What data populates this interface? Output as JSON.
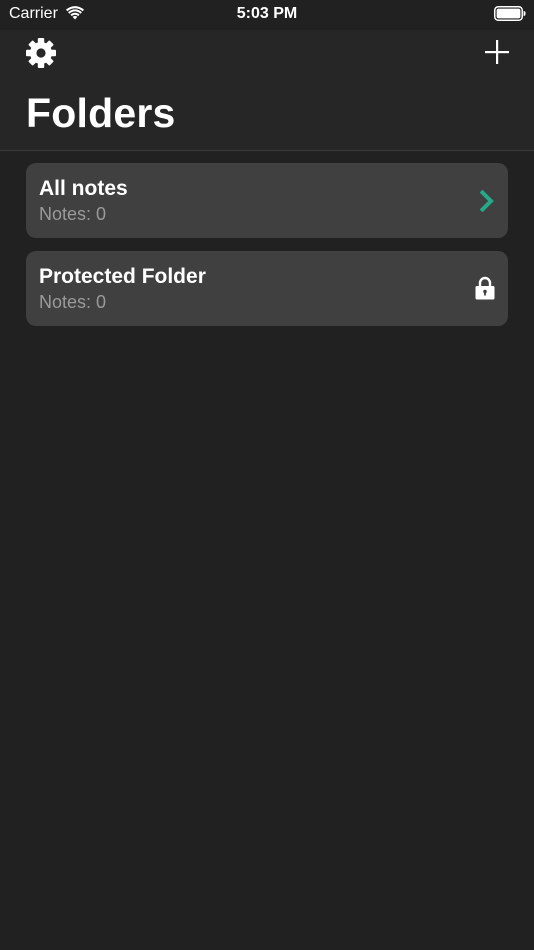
{
  "status_bar": {
    "carrier": "Carrier",
    "time": "5:03 PM",
    "wifi_icon": "wifi-icon",
    "battery_icon": "battery-icon"
  },
  "nav": {
    "title": "Folders",
    "settings_icon": "gear-icon",
    "add_icon": "plus-icon"
  },
  "folders": [
    {
      "name": "All notes",
      "notes_label": "Notes:",
      "count": "0",
      "accessory_icon": "chevron-right-icon"
    },
    {
      "name": "Protected Folder",
      "notes_label": "Notes:",
      "count": "0",
      "accessory_icon": "lock-icon"
    }
  ],
  "colors": {
    "background": "#212121",
    "nav_background": "#262626",
    "card": "#404040",
    "accent": "#26a889",
    "secondary_text": "#9a9a9a"
  }
}
